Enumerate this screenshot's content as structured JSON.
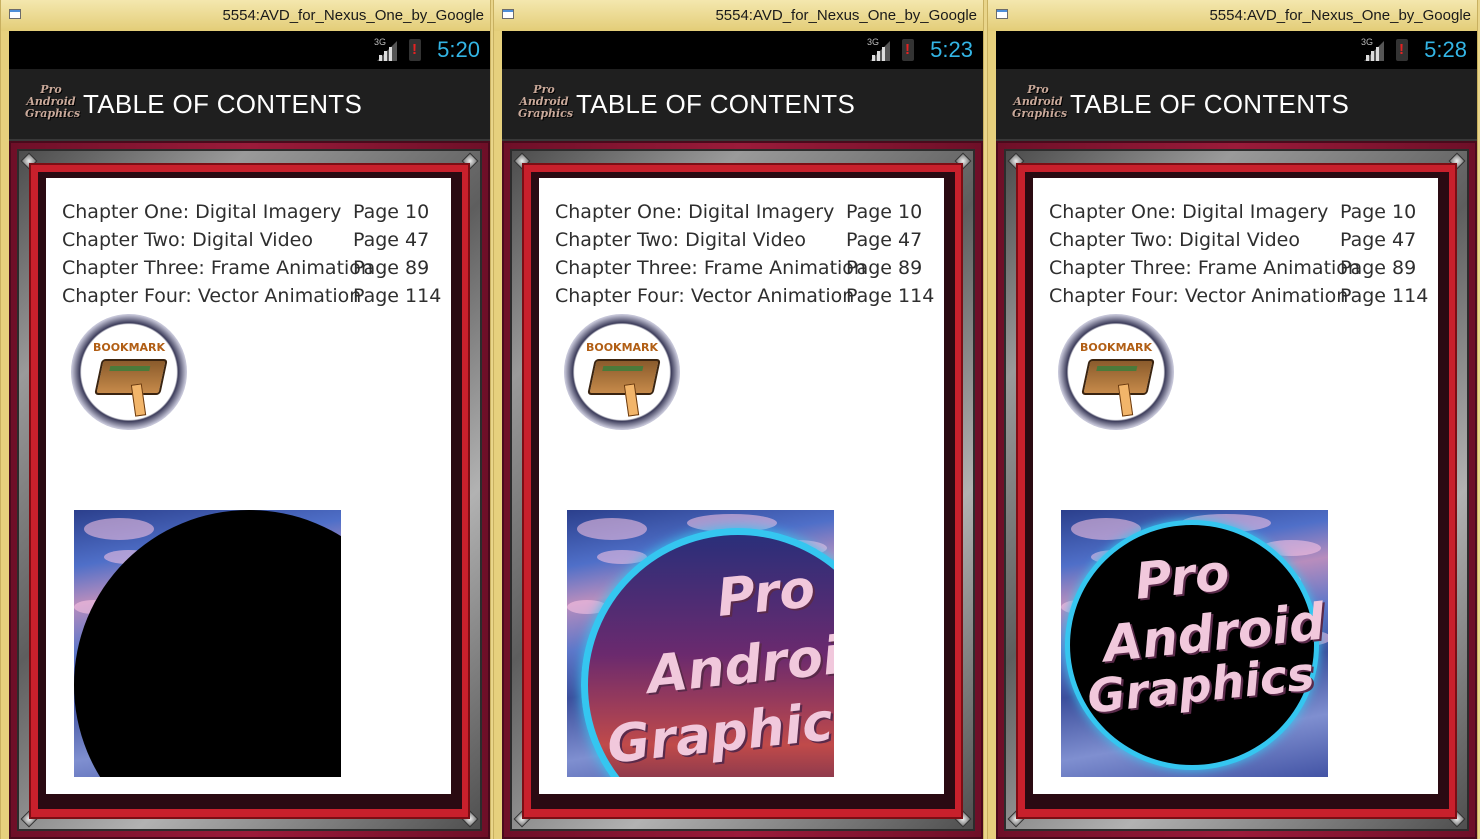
{
  "windows": [
    {
      "title": "5554:AVD_for_Nexus_One_by_Google",
      "status": {
        "network": "3G",
        "alert": "!",
        "time": "5:20"
      },
      "app": {
        "logo_lines": [
          "Pro",
          "Android",
          "Graphics"
        ],
        "title": "TABLE OF CONTENTS"
      },
      "toc": [
        {
          "chapter": "Chapter One: Digital Imagery",
          "page": "Page 10"
        },
        {
          "chapter": "Chapter Two: Digital Video",
          "page": "Page 47"
        },
        {
          "chapter": "Chapter Three: Frame Animation",
          "page": "Page 89"
        },
        {
          "chapter": "Chapter Four: Vector Animation",
          "page": "Page 114"
        }
      ],
      "bookmark_label": "BOOKMARK",
      "logo_image": {
        "state": "black disc sliding in over sky",
        "lines": []
      }
    },
    {
      "title": "5554:AVD_for_Nexus_One_by_Google",
      "status": {
        "network": "3G",
        "alert": "!",
        "time": "5:23"
      },
      "app": {
        "logo_lines": [
          "Pro",
          "Android",
          "Graphics"
        ],
        "title": "TABLE OF CONTENTS"
      },
      "toc": [
        {
          "chapter": "Chapter One: Digital Imagery",
          "page": "Page 10"
        },
        {
          "chapter": "Chapter Two: Digital Video",
          "page": "Page 47"
        },
        {
          "chapter": "Chapter Three: Frame Animation",
          "page": "Page 89"
        },
        {
          "chapter": "Chapter Four: Vector Animation",
          "page": "Page 114"
        }
      ],
      "bookmark_label": "BOOKMARK",
      "logo_image": {
        "state": "ringed sunset disc partially visible",
        "lines": [
          "Pro",
          "Android",
          "Graphic"
        ]
      }
    },
    {
      "title": "5554:AVD_for_Nexus_One_by_Google",
      "status": {
        "network": "3G",
        "alert": "!",
        "time": "5:28"
      },
      "app": {
        "logo_lines": [
          "Pro",
          "Android",
          "Graphics"
        ],
        "title": "TABLE OF CONTENTS"
      },
      "toc": [
        {
          "chapter": "Chapter One: Digital Imagery",
          "page": "Page 10"
        },
        {
          "chapter": "Chapter Two: Digital Video",
          "page": "Page 47"
        },
        {
          "chapter": "Chapter Three: Frame Animation",
          "page": "Page 89"
        },
        {
          "chapter": "Chapter Four: Vector Animation",
          "page": "Page 114"
        }
      ],
      "bookmark_label": "BOOKMARK",
      "logo_image": {
        "state": "black disc with cyan ring centered",
        "lines": [
          "Pro",
          "Android",
          "Graphics"
        ]
      }
    }
  ],
  "colors": {
    "clock": "#33b5e5",
    "frame_red": "#c8202c",
    "maroon": "#6e0f28",
    "ring_cyan": "#35c6f0"
  }
}
